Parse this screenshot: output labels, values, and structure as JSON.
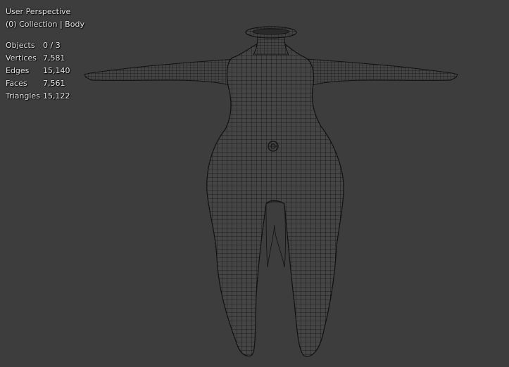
{
  "viewport": {
    "view_name": "User Perspective",
    "collection_info": "(0) Collection | Body"
  },
  "stats": [
    {
      "label": "Objects",
      "value": "0 / 3"
    },
    {
      "label": "Vertices",
      "value": "7,581"
    },
    {
      "label": "Edges",
      "value": "15,140"
    },
    {
      "label": "Faces",
      "value": "7,561"
    },
    {
      "label": "Triangles",
      "value": "15,122"
    }
  ],
  "colors": {
    "background": "#3d3d3d",
    "wire": "#111111",
    "mesh_fill": "#454545",
    "text": "#e6e6e6"
  },
  "icons": {
    "origin_marker": "object-origin-icon"
  }
}
